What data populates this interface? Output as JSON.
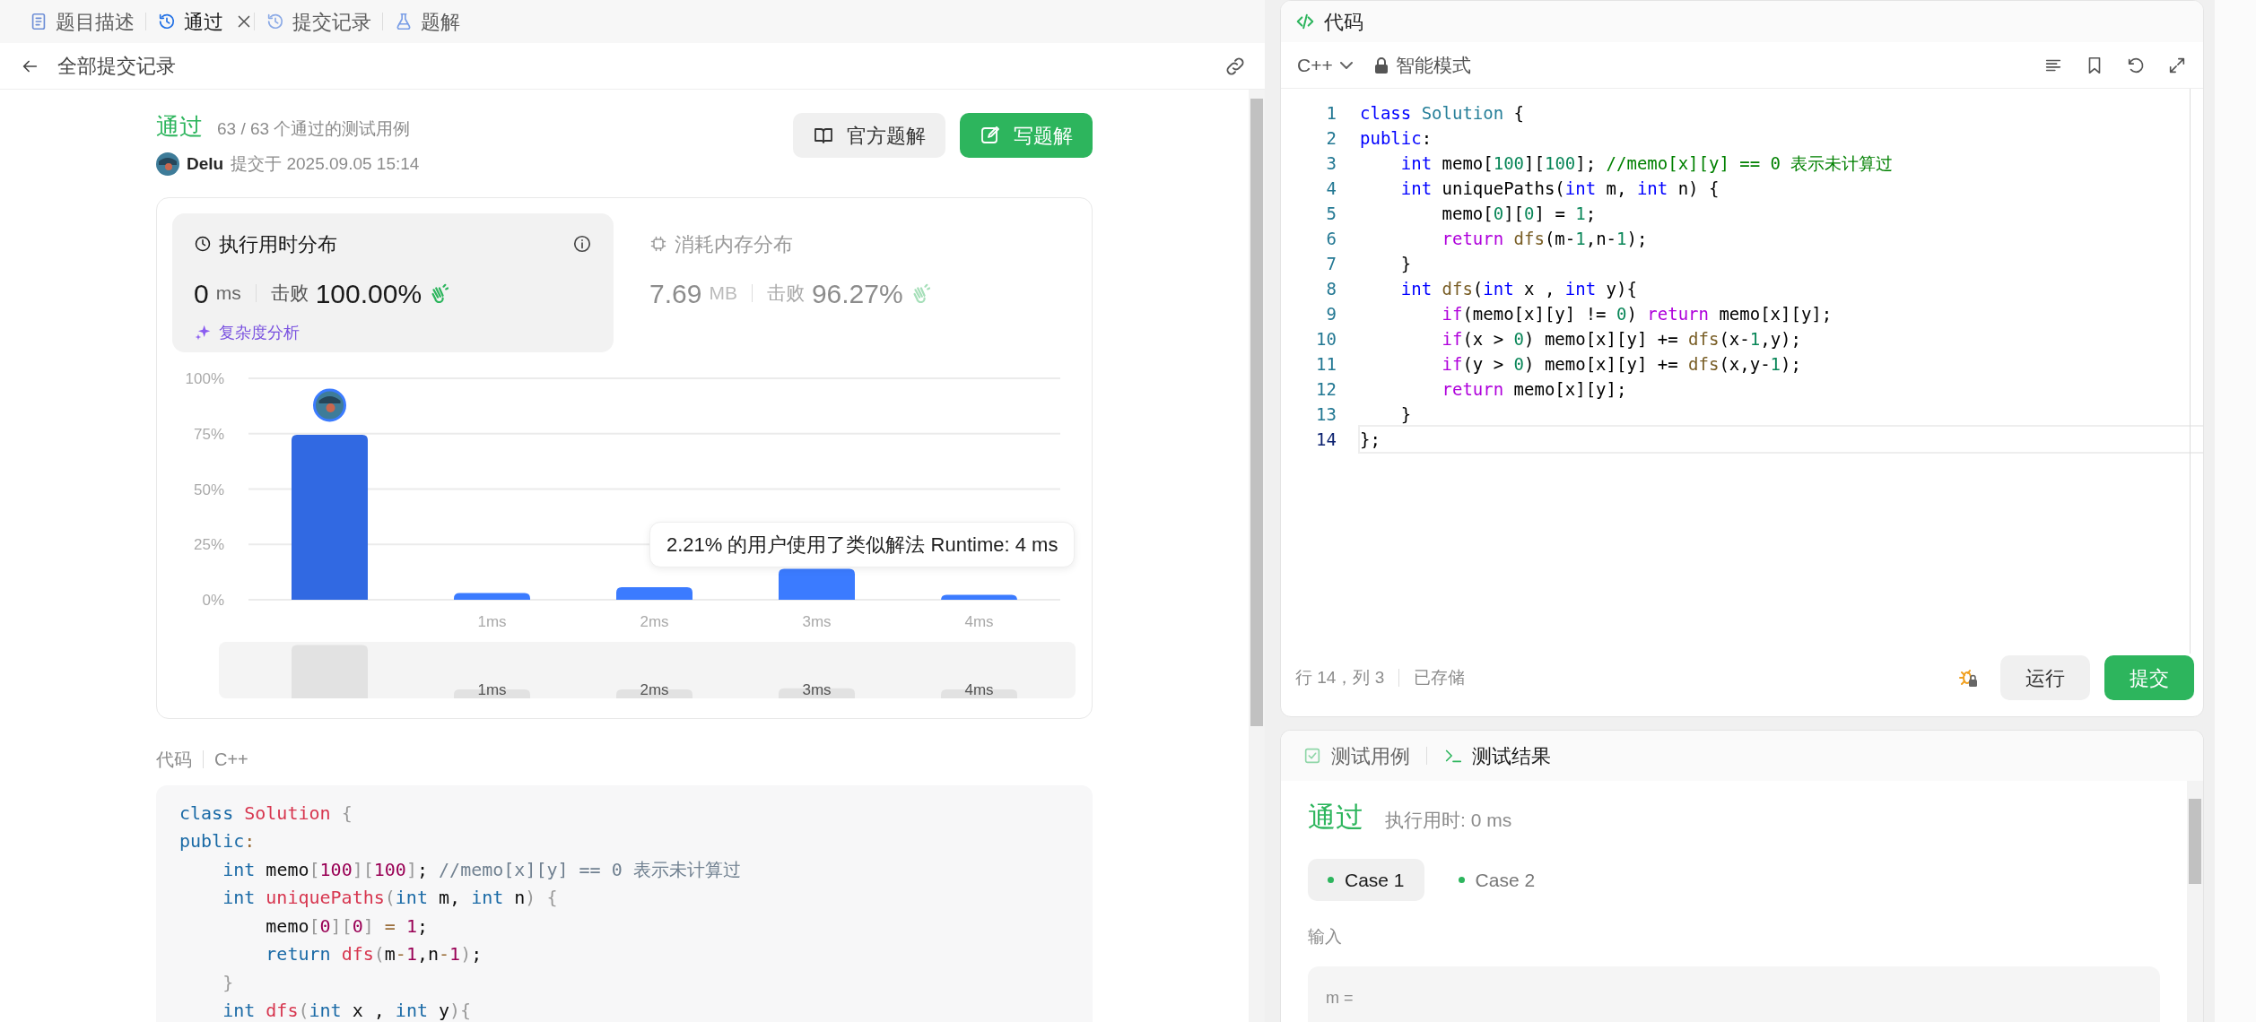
{
  "tabs": [
    {
      "label": "题目描述",
      "selected": false,
      "closable": false
    },
    {
      "label": "通过",
      "selected": true,
      "closable": true
    },
    {
      "label": "提交记录",
      "selected": false,
      "closable": false
    },
    {
      "label": "题解",
      "selected": false,
      "closable": false
    }
  ],
  "back": {
    "label": "全部提交记录"
  },
  "submission": {
    "status": "通过",
    "cases": "63 / 63 个通过的测试用例",
    "user": "Delu",
    "submitted": "提交于 2025.09.05 15:14",
    "buttons": [
      {
        "label": "官方题解",
        "kind": "secondary"
      },
      {
        "label": "写题解",
        "kind": "primary"
      }
    ]
  },
  "stats": [
    {
      "title": "执行用时分布",
      "value": "0",
      "unit": "ms",
      "beats_label": "击败",
      "beats": "100.00%",
      "selected": true,
      "link": "复杂度分析"
    },
    {
      "title": "消耗内存分布",
      "value": "7.69",
      "unit": "MB",
      "beats_label": "击败",
      "beats": "96.27%",
      "selected": false
    }
  ],
  "chart": {
    "tooltip": "2.21% 的用户使用了类似解法 Runtime: 4 ms",
    "navigator_labels": [
      "1ms",
      "2ms",
      "3ms",
      "4ms"
    ],
    "chart_data": {
      "type": "bar",
      "categories": [
        null,
        "1ms",
        "2ms",
        "3ms",
        "4ms"
      ],
      "values": [
        74.5,
        3,
        5.7,
        14,
        2.2
      ],
      "ylim": [
        0,
        100
      ],
      "grid": true,
      "yticks": [
        {
          "value": 0,
          "label": "0%"
        },
        {
          "value": 25,
          "label": "25%"
        },
        {
          "value": 50,
          "label": "50%"
        },
        {
          "value": 75,
          "label": "75%"
        },
        {
          "value": 100,
          "label": "100%"
        }
      ]
    }
  },
  "code_view": {
    "label": "代码",
    "language": "C++",
    "lines": [
      {
        "tokens": [
          {
            "kind": "kw",
            "text": "class "
          },
          {
            "kind": "fn",
            "text": "Solution "
          },
          {
            "kind": "pu",
            "text": "{"
          }
        ]
      },
      {
        "tokens": [
          {
            "kind": "kw",
            "text": "public"
          },
          {
            "kind": "op",
            "text": ":"
          }
        ]
      },
      {
        "tokens": [
          {
            "kind": "kw",
            "text": "    int"
          },
          {
            "kind": "pl",
            "text": " memo"
          },
          {
            "kind": "pu",
            "text": "["
          },
          {
            "kind": "num",
            "text": "100"
          },
          {
            "kind": "pu",
            "text": "]["
          },
          {
            "kind": "num",
            "text": "100"
          },
          {
            "kind": "pu",
            "text": "]"
          },
          {
            "kind": "pl",
            "text": "; "
          },
          {
            "kind": "cm",
            "text": "//memo[x][y] == 0 表示未计算过"
          }
        ]
      },
      {
        "tokens": [
          {
            "kind": "kw",
            "text": "    int "
          },
          {
            "kind": "fn",
            "text": "uniquePaths"
          },
          {
            "kind": "pu",
            "text": "("
          },
          {
            "kind": "kw",
            "text": "int"
          },
          {
            "kind": "pl",
            "text": " m, "
          },
          {
            "kind": "kw",
            "text": "int"
          },
          {
            "kind": "pl",
            "text": " n"
          },
          {
            "kind": "pu",
            "text": ") {"
          }
        ]
      },
      {
        "tokens": [
          {
            "kind": "pl",
            "text": "        memo"
          },
          {
            "kind": "pu",
            "text": "["
          },
          {
            "kind": "num",
            "text": "0"
          },
          {
            "kind": "pu",
            "text": "]["
          },
          {
            "kind": "num",
            "text": "0"
          },
          {
            "kind": "pu",
            "text": "] "
          },
          {
            "kind": "op",
            "text": "= "
          },
          {
            "kind": "num",
            "text": "1"
          },
          {
            "kind": "pl",
            "text": ";"
          }
        ]
      },
      {
        "tokens": [
          {
            "kind": "kw",
            "text": "        return "
          },
          {
            "kind": "fn",
            "text": "dfs"
          },
          {
            "kind": "pu",
            "text": "("
          },
          {
            "kind": "pl",
            "text": "m"
          },
          {
            "kind": "op",
            "text": "-"
          },
          {
            "kind": "num",
            "text": "1"
          },
          {
            "kind": "pl",
            "text": ",n"
          },
          {
            "kind": "op",
            "text": "-"
          },
          {
            "kind": "num",
            "text": "1"
          },
          {
            "kind": "pu",
            "text": ")"
          },
          {
            "kind": "pl",
            "text": ";"
          }
        ]
      },
      {
        "tokens": [
          {
            "kind": "pu",
            "text": "    }"
          }
        ]
      },
      {
        "tokens": [
          {
            "kind": "kw",
            "text": "    int "
          },
          {
            "kind": "fn",
            "text": "dfs"
          },
          {
            "kind": "pu",
            "text": "("
          },
          {
            "kind": "kw",
            "text": "int"
          },
          {
            "kind": "pl",
            "text": " x , "
          },
          {
            "kind": "kw",
            "text": "int"
          },
          {
            "kind": "pl",
            "text": " y"
          },
          {
            "kind": "pu",
            "text": "){"
          }
        ]
      }
    ]
  },
  "editor": {
    "title": "代码",
    "language": "C++",
    "mode": "智能模式",
    "lines": [
      {
        "number": "1",
        "current": false,
        "tokens": [
          {
            "kind": "kw",
            "text": "class "
          },
          {
            "kind": "ty",
            "text": "Solution"
          },
          {
            "kind": "pl",
            "text": " {"
          }
        ]
      },
      {
        "number": "2",
        "current": false,
        "tokens": [
          {
            "kind": "kw",
            "text": "public"
          },
          {
            "kind": "pl",
            "text": ":"
          }
        ]
      },
      {
        "number": "3",
        "current": false,
        "tokens": [
          {
            "kind": "kw",
            "text": "    int"
          },
          {
            "kind": "pl",
            "text": " memo["
          },
          {
            "kind": "num",
            "text": "100"
          },
          {
            "kind": "pl",
            "text": "]["
          },
          {
            "kind": "num",
            "text": "100"
          },
          {
            "kind": "pl",
            "text": "]; "
          },
          {
            "kind": "cm",
            "text": "//memo[x][y] == 0 表示未计算过"
          }
        ]
      },
      {
        "number": "4",
        "current": false,
        "tokens": [
          {
            "kind": "kw",
            "text": "    int"
          },
          {
            "kind": "pl",
            "text": " uniquePaths("
          },
          {
            "kind": "kw",
            "text": "int"
          },
          {
            "kind": "pl",
            "text": " m, "
          },
          {
            "kind": "kw",
            "text": "int"
          },
          {
            "kind": "pl",
            "text": " n) {"
          }
        ]
      },
      {
        "number": "5",
        "current": false,
        "tokens": [
          {
            "kind": "pl",
            "text": "        memo["
          },
          {
            "kind": "num",
            "text": "0"
          },
          {
            "kind": "pl",
            "text": "]["
          },
          {
            "kind": "num",
            "text": "0"
          },
          {
            "kind": "pl",
            "text": "] = "
          },
          {
            "kind": "num",
            "text": "1"
          },
          {
            "kind": "pl",
            "text": ";"
          }
        ]
      },
      {
        "number": "6",
        "current": false,
        "tokens": [
          {
            "kind": "ctl",
            "text": "        return "
          },
          {
            "kind": "fn",
            "text": "dfs"
          },
          {
            "kind": "pl",
            "text": "(m-"
          },
          {
            "kind": "num",
            "text": "1"
          },
          {
            "kind": "pl",
            "text": ",n-"
          },
          {
            "kind": "num",
            "text": "1"
          },
          {
            "kind": "pl",
            "text": ");"
          }
        ]
      },
      {
        "number": "7",
        "current": false,
        "tokens": [
          {
            "kind": "pl",
            "text": "    }"
          }
        ]
      },
      {
        "number": "8",
        "current": false,
        "tokens": [
          {
            "kind": "kw",
            "text": "    int "
          },
          {
            "kind": "fn",
            "text": "dfs"
          },
          {
            "kind": "pl",
            "text": "("
          },
          {
            "kind": "kw",
            "text": "int"
          },
          {
            "kind": "pl",
            "text": " x , "
          },
          {
            "kind": "kw",
            "text": "int"
          },
          {
            "kind": "pl",
            "text": " y){"
          }
        ]
      },
      {
        "number": "9",
        "current": false,
        "tokens": [
          {
            "kind": "ctl",
            "text": "        if"
          },
          {
            "kind": "pl",
            "text": "(memo[x][y] != "
          },
          {
            "kind": "num",
            "text": "0"
          },
          {
            "kind": "pl",
            "text": ") "
          },
          {
            "kind": "ctl",
            "text": "return"
          },
          {
            "kind": "pl",
            "text": " memo[x][y];"
          }
        ]
      },
      {
        "number": "10",
        "current": false,
        "tokens": [
          {
            "kind": "ctl",
            "text": "        if"
          },
          {
            "kind": "pl",
            "text": "(x > "
          },
          {
            "kind": "num",
            "text": "0"
          },
          {
            "kind": "pl",
            "text": ") memo[x][y] += "
          },
          {
            "kind": "fn",
            "text": "dfs"
          },
          {
            "kind": "pl",
            "text": "(x-"
          },
          {
            "kind": "num",
            "text": "1"
          },
          {
            "kind": "pl",
            "text": ",y);"
          }
        ]
      },
      {
        "number": "11",
        "current": false,
        "tokens": [
          {
            "kind": "ctl",
            "text": "        if"
          },
          {
            "kind": "pl",
            "text": "(y > "
          },
          {
            "kind": "num",
            "text": "0"
          },
          {
            "kind": "pl",
            "text": ") memo[x][y] += "
          },
          {
            "kind": "fn",
            "text": "dfs"
          },
          {
            "kind": "pl",
            "text": "(x,y-"
          },
          {
            "kind": "num",
            "text": "1"
          },
          {
            "kind": "pl",
            "text": ");"
          }
        ]
      },
      {
        "number": "12",
        "current": false,
        "tokens": [
          {
            "kind": "ctl",
            "text": "        return"
          },
          {
            "kind": "pl",
            "text": " memo[x][y];"
          }
        ]
      },
      {
        "number": "13",
        "current": false,
        "tokens": [
          {
            "kind": "pl",
            "text": "    }"
          }
        ]
      },
      {
        "number": "14",
        "current": true,
        "tokens": [
          {
            "kind": "pl",
            "text": "};"
          }
        ]
      }
    ],
    "status": {
      "position": "行 14，列 3",
      "saved": "已存储"
    },
    "buttons": [
      {
        "label": "运行",
        "kind": "secondary"
      },
      {
        "label": "提交",
        "kind": "primary"
      }
    ]
  },
  "test_panel": {
    "tabs": [
      {
        "label": "测试用例",
        "selected": false
      },
      {
        "label": "测试结果",
        "selected": true
      }
    ],
    "result": {
      "status": "通过",
      "runtime": "执行用时: 0 ms"
    },
    "cases": [
      {
        "label": "Case 1",
        "selected": true,
        "passed": true
      },
      {
        "label": "Case 2",
        "selected": false,
        "passed": true
      }
    ],
    "input_label": "输入",
    "inputs": [
      {
        "name": "m ="
      }
    ]
  }
}
